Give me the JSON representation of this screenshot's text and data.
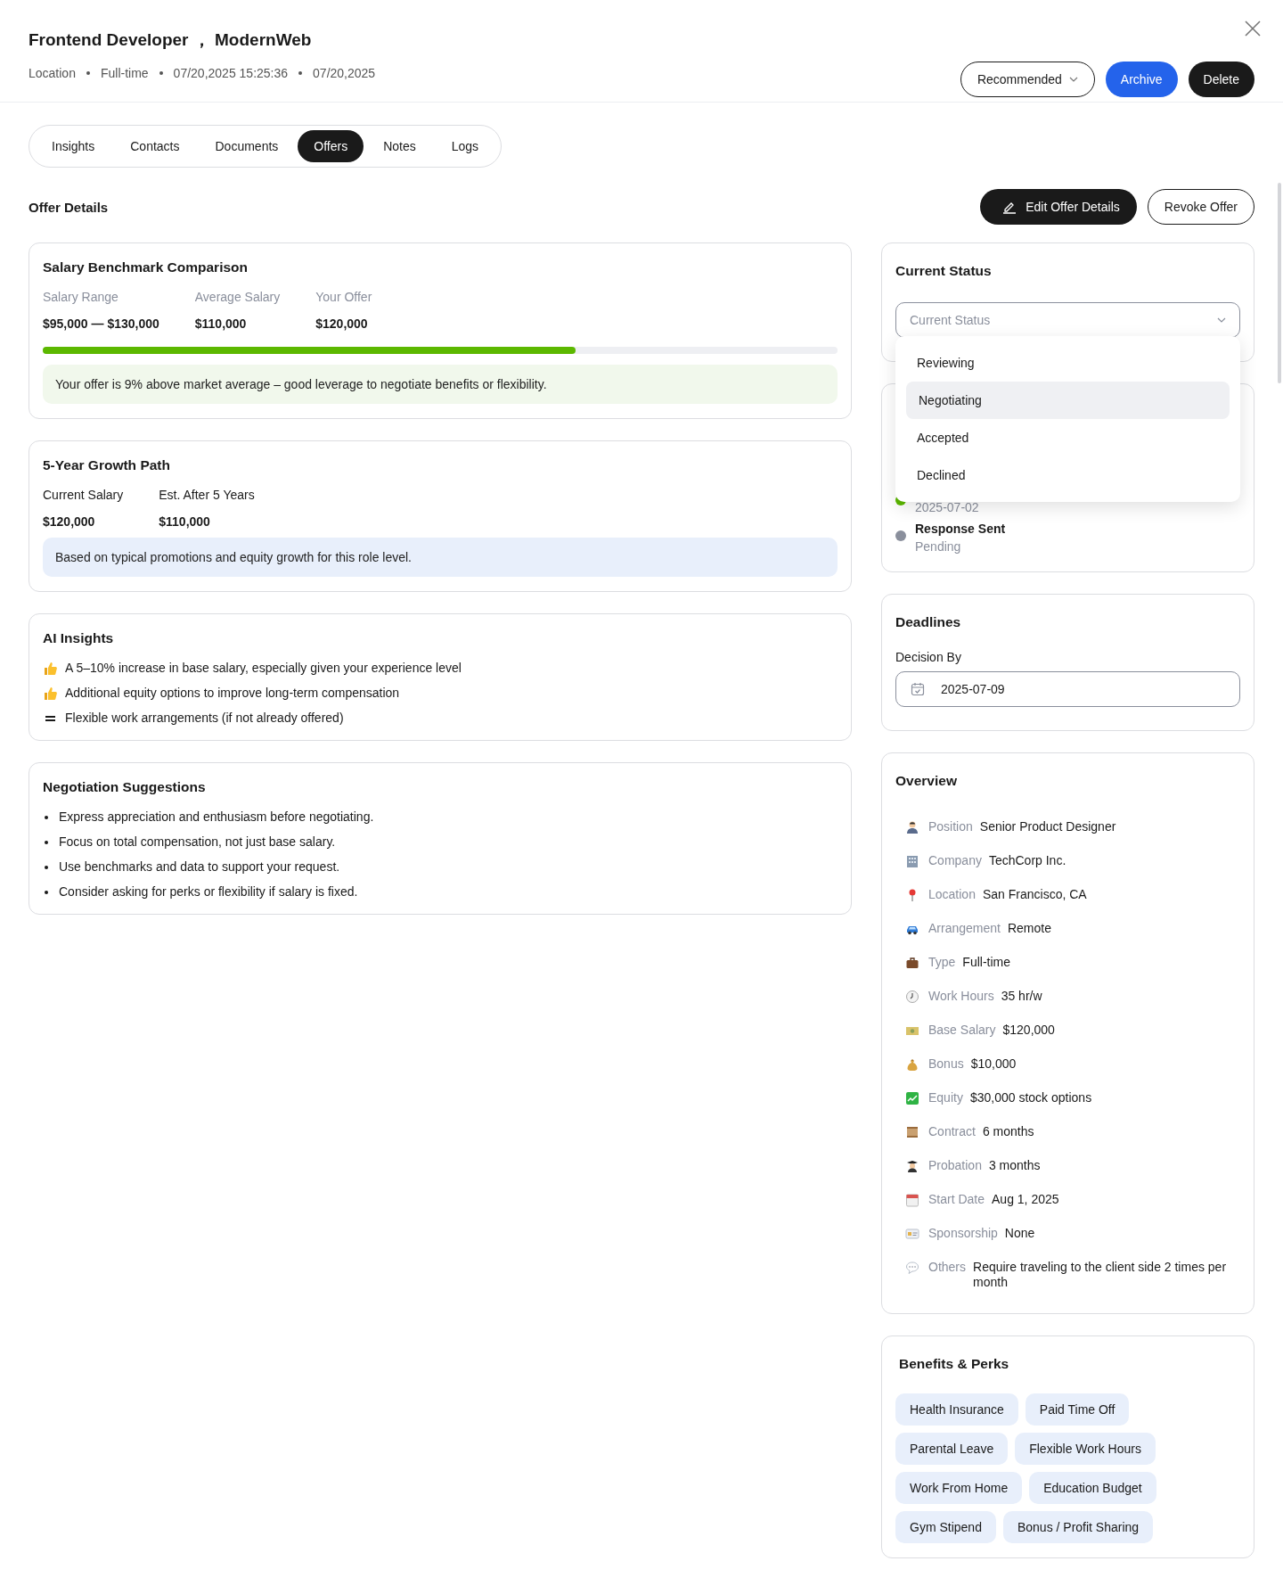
{
  "header": {
    "title": "Frontend Developer ， ModernWeb",
    "meta": [
      "Location",
      "Full-time",
      "07/20,2025 15:25:36",
      "07/20,2025"
    ],
    "filter": {
      "value": "Recommended"
    },
    "buttons": [
      {
        "label": "Archive",
        "kind": "primary"
      },
      {
        "label": "Delete",
        "kind": "dark"
      }
    ]
  },
  "tabs": [
    {
      "label": "Insights",
      "selected": false
    },
    {
      "label": "Contacts",
      "selected": false
    },
    {
      "label": "Documents",
      "selected": false
    },
    {
      "label": "Offers",
      "selected": true
    },
    {
      "label": "Notes",
      "selected": false
    },
    {
      "label": "Logs",
      "selected": false
    }
  ],
  "section": {
    "title": "Offer Details",
    "actions": [
      {
        "label": "Edit Offer Details",
        "kind": "dark"
      },
      {
        "label": "Revoke Offer",
        "kind": "outline"
      }
    ]
  },
  "benchmark": {
    "title": "Salary Benchmark Comparison",
    "stats": [
      {
        "label": "Salary Range",
        "value": "$95,000 — $130,000"
      },
      {
        "label": "Average Salary",
        "value": "$110,000"
      },
      {
        "label": "Your Offer",
        "value": "$120,000"
      }
    ],
    "level": 0.67,
    "note": "Your offer is 9% above market average – good leverage to negotiate benefits or flexibility."
  },
  "growth": {
    "title": "5-Year Growth Path",
    "stats": [
      {
        "label": "Current Salary",
        "value": "$120,000"
      },
      {
        "label": "Est. After 5 Years",
        "value": "$110,000"
      }
    ],
    "note": "Based on typical promotions and equity growth for this role level."
  },
  "ai_insights": {
    "title": "AI Insights",
    "items": [
      {
        "kind": "positive",
        "text": "A 5–10% increase in base salary, especially given your experience level"
      },
      {
        "kind": "positive",
        "text": "Additional equity options to improve long-term compensation"
      },
      {
        "kind": "neutral",
        "text": "Flexible work arrangements (if not already offered)"
      }
    ]
  },
  "negotiation": {
    "title": "Negotiation Suggestions",
    "items": [
      "Express appreciation and enthusiasm before negotiating.",
      "Focus on total compensation, not just base salary.",
      "Use benchmarks and data to support your request.",
      "Consider asking for perks or flexibility if salary is fixed."
    ]
  },
  "current_status": {
    "title": "Current Status",
    "placeholder": "Current Status",
    "expanded": true,
    "options": [
      {
        "label": "Reviewing",
        "selected": false
      },
      {
        "label": "Negotiating",
        "selected": true
      },
      {
        "label": "Accepted",
        "selected": false
      },
      {
        "label": "Declined",
        "selected": false
      }
    ]
  },
  "timeline": [
    {
      "date": "2025-07-02",
      "color": "#5cb800"
    },
    {
      "title": "Response Sent",
      "date": "Pending",
      "color": "#8a8f9c"
    }
  ],
  "deadlines": {
    "title": "Deadlines",
    "label": "Decision By",
    "value": "2025-07-09"
  },
  "overview": {
    "title": "Overview",
    "rows": [
      {
        "label": "Position",
        "value": "Senior Product Designer"
      },
      {
        "label": "Company",
        "value": "TechCorp Inc."
      },
      {
        "label": "Location",
        "value": "San Francisco, CA"
      },
      {
        "label": "Arrangement",
        "value": "Remote"
      },
      {
        "label": "Type",
        "value": "Full-time"
      },
      {
        "label": "Work Hours",
        "value": "35 hr/w"
      },
      {
        "label": "Base Salary",
        "value": "$120,000"
      },
      {
        "label": "Bonus",
        "value": "$10,000"
      },
      {
        "label": "Equity",
        "value": "$30,000 stock options"
      },
      {
        "label": "Contract",
        "value": "6 months"
      },
      {
        "label": "Probation",
        "value": "3 months"
      },
      {
        "label": "Start Date",
        "value": "Aug 1, 2025"
      },
      {
        "label": "Sponsorship",
        "value": "None"
      },
      {
        "label": "Others",
        "value": "Require traveling to the client side 2 times per month"
      }
    ]
  },
  "benefits": {
    "title": "Benefits & Perks",
    "tags": [
      "Health Insurance",
      "Paid Time Off",
      "Parental Leave",
      "Flexible Work Hours",
      "Work From Home",
      "Education Budget",
      "Gym Stipend",
      "Bonus / Profit Sharing"
    ]
  }
}
